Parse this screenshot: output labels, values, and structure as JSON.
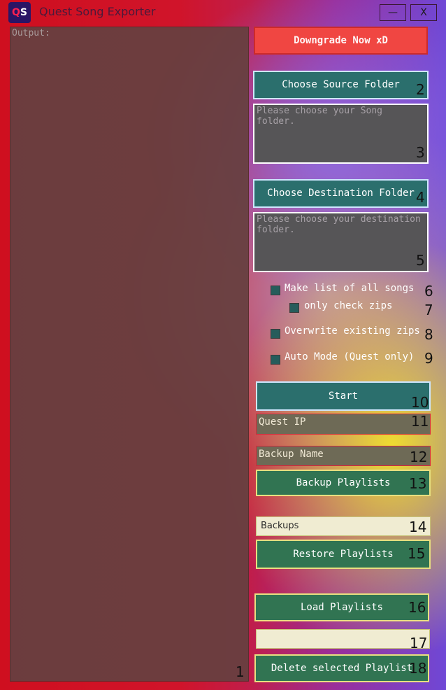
{
  "window": {
    "title": "Quest Song Exporter",
    "icon_text": {
      "q": "Q",
      "s": "S"
    },
    "minimize_label": "—",
    "close_label": "X"
  },
  "output": {
    "label": "Output:"
  },
  "downgrade_button": {
    "label": "Downgrade Now xD"
  },
  "source": {
    "button_label": "Choose Source Folder",
    "placeholder": "Please choose your Song folder."
  },
  "destination": {
    "button_label": "Choose Destination Folder",
    "placeholder": "Please choose your destination folder."
  },
  "options": {
    "list_all_songs": "Make list of all songs",
    "only_zips": "only check zips",
    "overwrite": "Overwrite existing zips",
    "auto_mode": "Auto Mode (Quest only)"
  },
  "start_button": {
    "label": "Start"
  },
  "quest_ip": {
    "placeholder": "Quest IP"
  },
  "backup_name": {
    "placeholder": "Backup Name"
  },
  "backup_playlists_button": {
    "label": "Backup Playlists"
  },
  "backups_select": {
    "value": "Backups"
  },
  "restore_playlists_button": {
    "label": "Restore Playlists"
  },
  "load_playlists_button": {
    "label": "Load Playlists"
  },
  "playlist_select": {
    "value": ""
  },
  "delete_playlist_button": {
    "label": "Delete selected Playlist"
  },
  "numbers": [
    "1",
    "2",
    "3",
    "4",
    "5",
    "6",
    "7",
    "8",
    "9",
    "10",
    "11",
    "12",
    "13",
    "14",
    "15",
    "16",
    "17",
    "18"
  ]
}
